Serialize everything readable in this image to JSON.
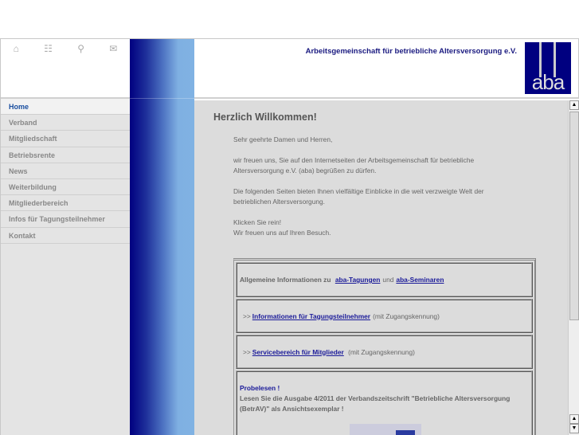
{
  "toolbar_icons": [
    "home-icon",
    "sitemap-icon",
    "search-icon",
    "mail-icon"
  ],
  "nav": [
    "Home",
    "Verband",
    "Mitgliedschaft",
    "Betriebsrente",
    "News",
    "Weiterbildung",
    "Mitgliederbereich",
    "Infos für Tagungsteilnehmer",
    "Kontakt"
  ],
  "header": {
    "org": "Arbeitsgemeinschaft für betriebliche Altersversorgung e.V.",
    "logo": "aba"
  },
  "main": {
    "title": "Herzlich Willkommen!",
    "p1": "Sehr geehrte Damen und Herren,",
    "p2": "wir freuen uns, Sie auf den Internetseiten der Arbeitsgemeinschaft für betriebliche Altersversorgung e.V. (aba) begrüßen zu dürfen.",
    "p3": "Die folgenden Seiten bieten Ihnen vielfältige Einblicke in die weit verzweigte Welt der betrieblichen Altersversorgung.",
    "p4a": "Klicken Sie rein!",
    "p4b": "Wir freuen uns auf Ihren Besuch.",
    "box1": {
      "pre": "Allgemeine Informationen zu",
      "link1": "aba-Tagungen",
      "mid": "und",
      "link2": "aba-Seminaren"
    },
    "box2": {
      "arrow": ">>",
      "link": "Informationen für Tagungsteilnehmer",
      "note": "(mit Zugangskennung)"
    },
    "box3": {
      "arrow": ">>",
      "link": "Servicebereich für Mitglieder",
      "note": "(mit Zugangskennung)"
    },
    "box4": {
      "title": "Probelesen !",
      "text": "Lesen Sie die Ausgabe 4/2011 der Verbandszeitschrift \"Betriebliche Altersversorgung (BetrAV)\" als Ansichtsexemplar !"
    }
  }
}
